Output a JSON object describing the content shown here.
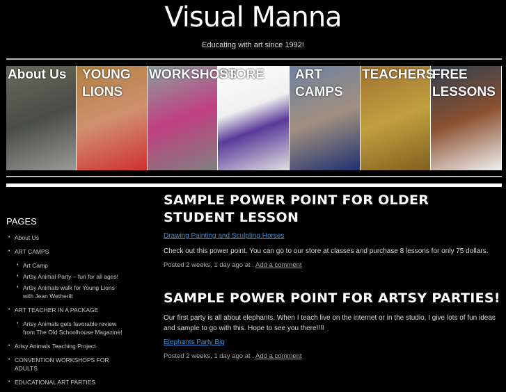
{
  "site": {
    "title": "Visual Manna",
    "tagline": "Educating with art since 1992!"
  },
  "nav": [
    {
      "label": "About Us",
      "bg": "linear-gradient(160deg,#6a6a5a,#4a4c46 50%,#9a9a96)"
    },
    {
      "label": "YOUNG LIONS",
      "bg": "linear-gradient(160deg,#b08040,#d09070 50%,#d03030)"
    },
    {
      "label": "WORKSHOPS",
      "bg": "linear-gradient(160deg,#8aa0a0,#c04080 50%,#808080)"
    },
    {
      "label": "STORE",
      "bg": "linear-gradient(160deg,#ffffff,#f0f0f0 40%,#5a3a9a 60%,#e0e0e0)"
    },
    {
      "label": "ART CAMPS",
      "bg": "linear-gradient(160deg,#7080a0,#a09080 50%,#203070)"
    },
    {
      "label": "TEACHERS",
      "bg": "linear-gradient(160deg,#a07030,#c0a040 50%,#806020)"
    },
    {
      "label": "FREE LESSONS",
      "bg": "linear-gradient(160deg,#304050,#8a5030 50%,#f0f0f0)"
    }
  ],
  "sidebar": {
    "heading": "PAGES",
    "items": [
      {
        "label": "About Us",
        "children": []
      },
      {
        "label": "ART CAMPS",
        "children": [
          "Art Camp",
          "Artsy Animal Party – fun for all ages!",
          "Artsy Animals walk for Young Lions with Jean Wetherilt"
        ]
      },
      {
        "label": "ART TEACHER IN A PACKAGE",
        "children": [
          "Artsy Animals gets favorable review from The Old Schoolhouse Magazine!"
        ]
      },
      {
        "label": "Artsy Animals Teaching Project",
        "children": []
      },
      {
        "label": "CONVENTION WORKSHOPS FOR ADULTS",
        "children": []
      },
      {
        "label": "EDUCATIONAL ART PARTIES",
        "children": []
      }
    ]
  },
  "posts": [
    {
      "title": "SAMPLE POWER POINT FOR OLDER STUDENT LESSON",
      "link": "Drawing Painting and Sculpting Horses",
      "body": "Check out this power point.  You can go to our store at classes and purchase 8 lessons for only 75 dollars.",
      "meta": "Posted 2 weeks, 1 day ago at . ",
      "comment": "Add a comment",
      "link_first": true
    },
    {
      "title": "SAMPLE POWER POINT FOR ARTSY PARTIES!",
      "link": "Elephants Party Big",
      "body": "Our first party is all about elephants.  When I teach live on the internet or in the studio, I give lots of fun ideas and sample to go with this.  Hope to see you there!!!!",
      "meta": "Posted 2 weeks, 1 day ago at . ",
      "comment": "Add a comment",
      "link_first": false
    }
  ]
}
